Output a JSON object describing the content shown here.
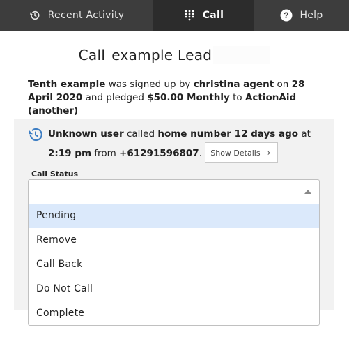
{
  "nav": {
    "tabs": [
      {
        "label": "Recent Activity",
        "icon": "history-icon"
      },
      {
        "label": "Call",
        "icon": "dialpad-icon",
        "active": true
      },
      {
        "label": "Help",
        "icon": "help-icon"
      }
    ]
  },
  "header": {
    "label": "Call",
    "lead_name": "example Lead"
  },
  "summary": {
    "name": "Tenth example",
    "text1": " was signed up by ",
    "agent": "christina agent",
    "text2": " on ",
    "date": "28 April 2020",
    "text3": " and pledged ",
    "pledge": "$50.00 Monthly",
    "text4": " to ",
    "org": "ActionAid (another)"
  },
  "last_call": {
    "caller": "Unknown user",
    "text1": " called ",
    "target": "home number 12 days ago",
    "text2": " at ",
    "time": "2:19 pm",
    "text3": " from ",
    "number": "+61291596807",
    "text4": ".",
    "details_button": "Show Details"
  },
  "call_status": {
    "label": "Call Status",
    "selected": "",
    "options": [
      "Pending",
      "Remove",
      "Call Back",
      "Do Not Call",
      "Complete"
    ],
    "highlighted": "Pending"
  },
  "colors": {
    "nav_bg": "#3d3d3d",
    "nav_active": "#2c2c2c",
    "panel_bg": "#f2f2f2",
    "highlight": "#dbe9fb",
    "icon_blue": "#3f7fc4"
  }
}
